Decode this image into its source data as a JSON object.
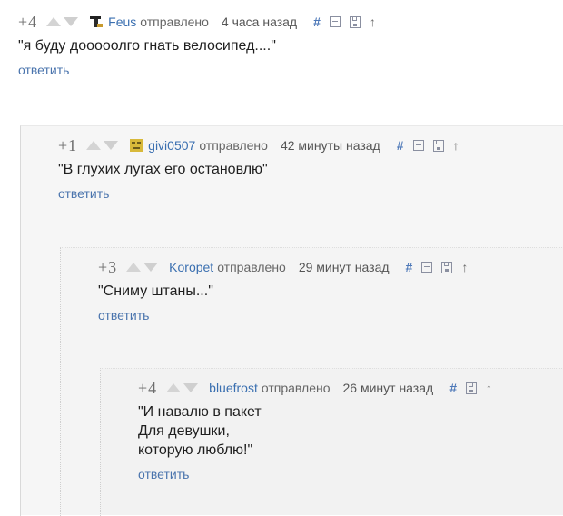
{
  "comments": [
    {
      "score": "+4",
      "author": "Feus",
      "sent": "отправлено",
      "time": "4 часа назад",
      "text_lines": [
        "\"я буду дооооолго гнать велосипед....\""
      ],
      "reply": "ответить",
      "hash": "#",
      "up": "↑"
    },
    {
      "score": "+1",
      "author": "givi0507",
      "sent": "отправлено",
      "time": "42 минуты назад",
      "text_lines": [
        "\"В глухих лугах его остановлю\""
      ],
      "reply": "ответить",
      "hash": "#",
      "up": "↑"
    },
    {
      "score": "+3",
      "author": "Koropet",
      "sent": "отправлено",
      "time": "29 минут назад",
      "text_lines": [
        "\"Сниму штаны...\""
      ],
      "reply": "ответить",
      "hash": "#",
      "up": "↑"
    },
    {
      "score": "+4",
      "author": "bluefrost",
      "sent": "отправлено",
      "time": "26 минут назад",
      "text_lines": [
        "\"И навалю в пакет",
        "Для девушки,",
        "которую люблю!\""
      ],
      "reply": "ответить",
      "hash": "#",
      "up": "↑"
    }
  ]
}
